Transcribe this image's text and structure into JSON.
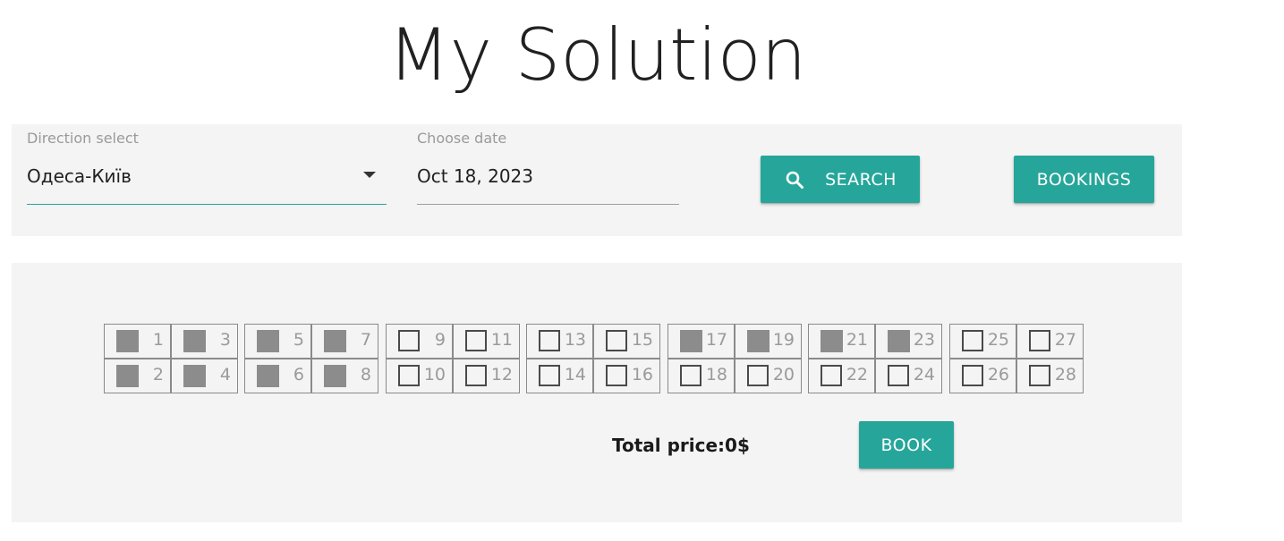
{
  "page": {
    "title": "My Solution"
  },
  "filters": {
    "direction_label": "Direction select",
    "direction_value": "Одеса-Київ",
    "date_label": "Choose date",
    "date_value": "Oct 18, 2023",
    "search_label": "SEARCH",
    "bookings_label": "BOOKINGS"
  },
  "seats": [
    {
      "number": "1",
      "status": "booked"
    },
    {
      "number": "2",
      "status": "booked"
    },
    {
      "number": "3",
      "status": "booked"
    },
    {
      "number": "4",
      "status": "booked"
    },
    {
      "number": "5",
      "status": "booked"
    },
    {
      "number": "6",
      "status": "booked"
    },
    {
      "number": "7",
      "status": "booked"
    },
    {
      "number": "8",
      "status": "booked"
    },
    {
      "number": "9",
      "status": "free"
    },
    {
      "number": "10",
      "status": "free"
    },
    {
      "number": "11",
      "status": "free"
    },
    {
      "number": "12",
      "status": "free"
    },
    {
      "number": "13",
      "status": "free"
    },
    {
      "number": "14",
      "status": "free"
    },
    {
      "number": "15",
      "status": "free"
    },
    {
      "number": "16",
      "status": "free"
    },
    {
      "number": "17",
      "status": "booked"
    },
    {
      "number": "18",
      "status": "free"
    },
    {
      "number": "19",
      "status": "booked"
    },
    {
      "number": "20",
      "status": "free"
    },
    {
      "number": "21",
      "status": "booked"
    },
    {
      "number": "22",
      "status": "free"
    },
    {
      "number": "23",
      "status": "booked"
    },
    {
      "number": "24",
      "status": "free"
    },
    {
      "number": "25",
      "status": "free"
    },
    {
      "number": "26",
      "status": "free"
    },
    {
      "number": "27",
      "status": "free"
    },
    {
      "number": "28",
      "status": "free"
    }
  ],
  "summary": {
    "total_price": "Total price:0$",
    "book_label": "BOOK"
  },
  "colors": {
    "accent": "#26a69a",
    "booked_seat": "#8c8c8c",
    "panel_bg": "#f4f4f4"
  }
}
